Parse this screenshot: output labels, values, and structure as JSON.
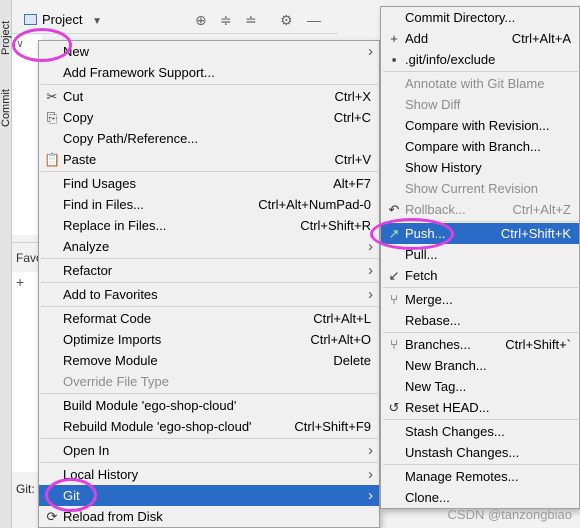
{
  "ide": {
    "project_title": "Project",
    "left_tabs": [
      "Project",
      "Commit"
    ],
    "favorites_label": "Favo",
    "git_label": "Git:"
  },
  "main_menu": [
    {
      "label": "New",
      "arrow": true
    },
    {
      "label": "Add Framework Support..."
    },
    {
      "sep": true
    },
    {
      "icon": "✂",
      "label": "Cut",
      "shortcut": "Ctrl+X"
    },
    {
      "icon": "⎘",
      "label": "Copy",
      "shortcut": "Ctrl+C"
    },
    {
      "label": "Copy Path/Reference..."
    },
    {
      "icon": "📋",
      "label": "Paste",
      "shortcut": "Ctrl+V"
    },
    {
      "sep": true
    },
    {
      "label": "Find Usages",
      "shortcut": "Alt+F7"
    },
    {
      "label": "Find in Files...",
      "shortcut": "Ctrl+Alt+NumPad-0"
    },
    {
      "label": "Replace in Files...",
      "shortcut": "Ctrl+Shift+R"
    },
    {
      "label": "Analyze",
      "arrow": true
    },
    {
      "sep": true
    },
    {
      "label": "Refactor",
      "arrow": true
    },
    {
      "sep": true
    },
    {
      "label": "Add to Favorites",
      "arrow": true
    },
    {
      "sep": true
    },
    {
      "label": "Reformat Code",
      "shortcut": "Ctrl+Alt+L"
    },
    {
      "label": "Optimize Imports",
      "shortcut": "Ctrl+Alt+O"
    },
    {
      "label": "Remove Module",
      "shortcut": "Delete"
    },
    {
      "label": "Override File Type",
      "disabled": true
    },
    {
      "sep": true
    },
    {
      "label": "Build Module 'ego-shop-cloud'"
    },
    {
      "label": "Rebuild Module 'ego-shop-cloud'",
      "shortcut": "Ctrl+Shift+F9"
    },
    {
      "sep": true
    },
    {
      "label": "Open In",
      "arrow": true
    },
    {
      "sep": true
    },
    {
      "label": "Local History",
      "arrow": true
    },
    {
      "label": "Git",
      "arrow": true,
      "selected": true
    },
    {
      "icon": "⟳",
      "label": "Reload from Disk"
    }
  ],
  "git_menu": [
    {
      "label": "Commit Directory..."
    },
    {
      "icon": "+",
      "label": "Add",
      "shortcut": "Ctrl+Alt+A"
    },
    {
      "icon": "▪",
      "label": ".git/info/exclude"
    },
    {
      "sep": true
    },
    {
      "label": "Annotate with Git Blame",
      "disabled": true
    },
    {
      "label": "Show Diff",
      "disabled": true
    },
    {
      "label": "Compare with Revision..."
    },
    {
      "label": "Compare with Branch..."
    },
    {
      "label": "Show History"
    },
    {
      "label": "Show Current Revision",
      "disabled": true
    },
    {
      "icon": "↶",
      "label": "Rollback...",
      "shortcut": "Ctrl+Alt+Z",
      "disabled": true
    },
    {
      "sep": true
    },
    {
      "icon": "↗",
      "label": "Push...",
      "shortcut": "Ctrl+Shift+K",
      "selected": true
    },
    {
      "label": "Pull..."
    },
    {
      "icon": "↙",
      "label": "Fetch"
    },
    {
      "sep": true
    },
    {
      "icon": "⑂",
      "label": "Merge..."
    },
    {
      "label": "Rebase..."
    },
    {
      "sep": true
    },
    {
      "icon": "⑂",
      "label": "Branches...",
      "shortcut": "Ctrl+Shift+`"
    },
    {
      "label": "New Branch..."
    },
    {
      "label": "New Tag..."
    },
    {
      "icon": "↺",
      "label": "Reset HEAD..."
    },
    {
      "sep": true
    },
    {
      "label": "Stash Changes..."
    },
    {
      "label": "Unstash Changes..."
    },
    {
      "sep": true
    },
    {
      "label": "Manage Remotes..."
    },
    {
      "label": "Clone..."
    }
  ],
  "watermark": "CSDN @tanzongbiao",
  "colors": {
    "selection": "#2a6bc7",
    "highlight_circle": "#e040e0"
  }
}
